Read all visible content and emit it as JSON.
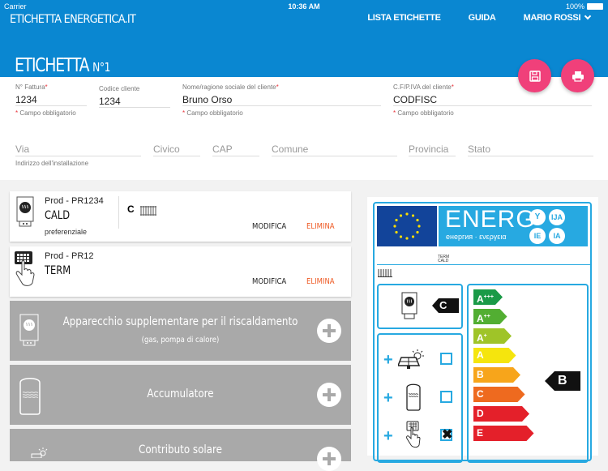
{
  "status_bar": {
    "carrier": "Carrier",
    "time": "10:36 AM",
    "battery": "100%"
  },
  "header": {
    "brand": "ETICHETTA ENERGETICA.IT",
    "nav": [
      "LISTA ETICHETTE",
      "GUIDA",
      "MARIO ROSSI"
    ],
    "page_title": "ETICHETTA",
    "page_number": "N°1",
    "accent_color": "#0a87d1",
    "fab_color": "#f0407a"
  },
  "form": {
    "invoice": {
      "label": "N° Fattura",
      "value": "1234",
      "hint": "Campo obbligatorio"
    },
    "client_code": {
      "label": "Codice cliente",
      "value": "1234"
    },
    "client_name": {
      "label": "Nome/ragione sociale del cliente",
      "value": "Bruno Orso",
      "hint": "Campo obbligatorio"
    },
    "tax_id": {
      "label": "C.F/P.IVA del cliente",
      "value": "CODFISC",
      "hint": "Campo obbligatorio"
    },
    "address": {
      "via": "Via",
      "civico": "Civico",
      "cap": "CAP",
      "comune": "Comune",
      "provincia": "Provincia",
      "stato": "Stato",
      "hint": "Indirizzo dell'installazione"
    }
  },
  "products": [
    {
      "code": "Prod - PR1234",
      "name": "CALD",
      "subtitle": "preferenziale",
      "class": "C",
      "edit": "MODIFICA",
      "delete": "ELIMINA"
    },
    {
      "code": "Prod - PR12",
      "name": "TERM",
      "edit": "MODIFICA",
      "delete": "ELIMINA"
    }
  ],
  "add_sections": [
    {
      "title": "Apparecchio supplementare per il riscaldamento",
      "subtitle": "(gas, pompa di calore)"
    },
    {
      "title": "Accumulatore"
    },
    {
      "title": "Contributo solare"
    }
  ],
  "energy_label": {
    "energ": "ENERG",
    "subtitle": "енергия · ενεργεια",
    "lang_badges": [
      "Y",
      "IJA",
      "IE",
      "IA"
    ],
    "product_names": [
      "TERM",
      "CALD"
    ],
    "heater_class": "C",
    "package_class": "B",
    "classes": [
      {
        "label": "A",
        "sup": "+++",
        "color": "#1a9a47"
      },
      {
        "label": "A",
        "sup": "++",
        "color": "#52ae32"
      },
      {
        "label": "A",
        "sup": "+",
        "color": "#9fc428"
      },
      {
        "label": "A",
        "sup": "",
        "color": "#f5e50d"
      },
      {
        "label": "B",
        "sup": "",
        "color": "#f7a51b"
      },
      {
        "label": "C",
        "sup": "",
        "color": "#ee6a1f"
      },
      {
        "label": "D",
        "sup": "",
        "color": "#e4202a"
      },
      {
        "label": "E",
        "sup": "",
        "color": "#e4202a"
      }
    ],
    "components": [
      {
        "name": "solar",
        "checked": false
      },
      {
        "name": "storage",
        "checked": false
      },
      {
        "name": "thermostat",
        "checked": true
      }
    ]
  }
}
